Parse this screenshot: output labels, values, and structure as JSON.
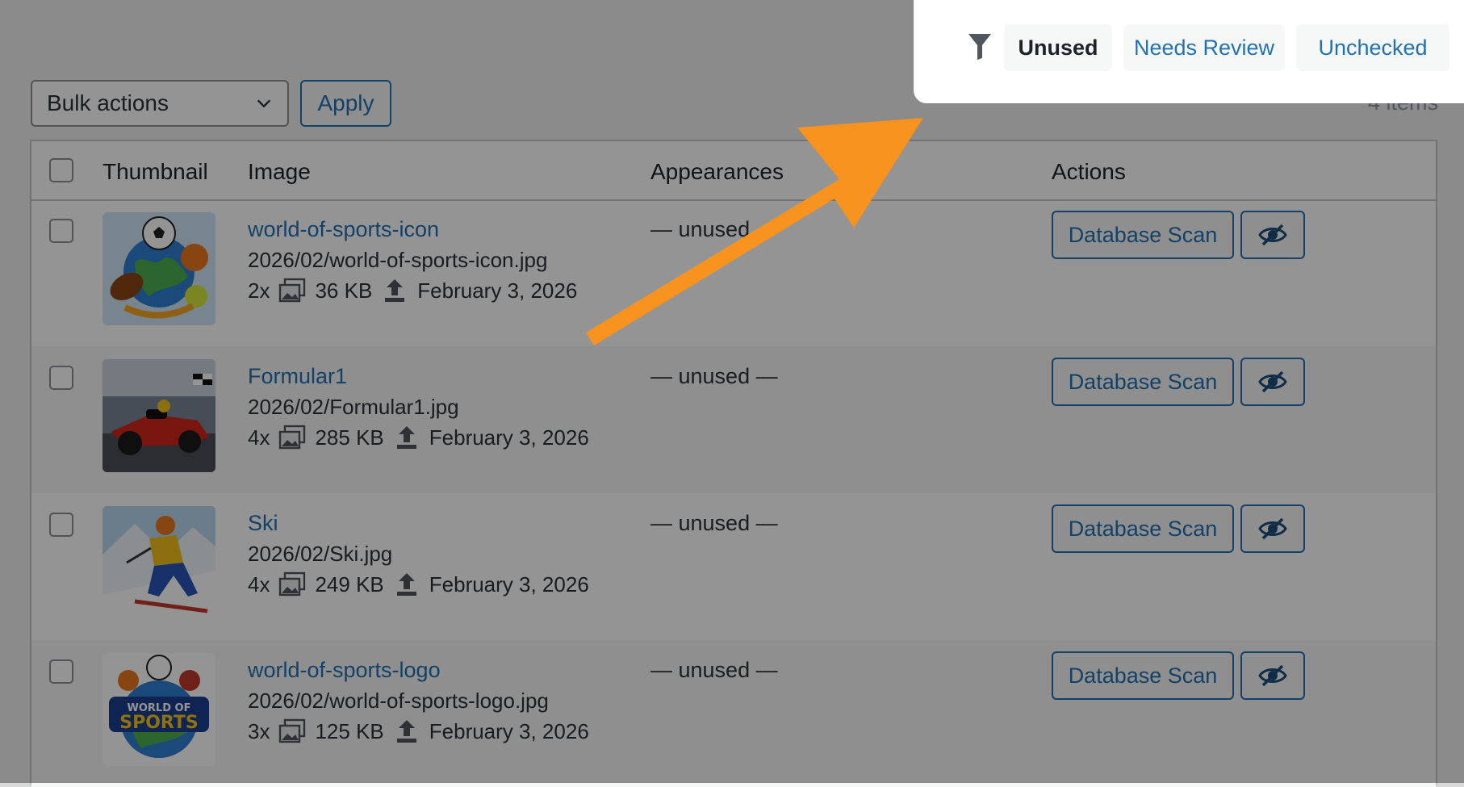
{
  "toolbar": {
    "bulk_select": "Bulk actions",
    "apply_label": "Apply",
    "items_count": "4 items"
  },
  "filters": {
    "icon": "filter-icon",
    "items": [
      {
        "label": "Unused",
        "state": "active"
      },
      {
        "label": "Needs Review",
        "state": "link"
      },
      {
        "label": "Unchecked",
        "state": "link"
      }
    ]
  },
  "table": {
    "headers": {
      "thumbnail": "Thumbnail",
      "image": "Image",
      "appearances": "Appearances",
      "actions": "Actions"
    },
    "rows": [
      {
        "title": "world-of-sports-icon",
        "path": "2026/02/world-of-sports-icon.jpg",
        "sizes": "2x",
        "filesize": "36 KB",
        "date": "February 3, 2026",
        "appearances": "— unused —",
        "scan_label": "Database Scan",
        "thumb": "globe-sports-balls"
      },
      {
        "title": "Formular1",
        "path": "2026/02/Formular1.jpg",
        "sizes": "4x",
        "filesize": "285 KB",
        "date": "February 3, 2026",
        "appearances": "— unused —",
        "scan_label": "Database Scan",
        "thumb": "formula-one-car"
      },
      {
        "title": "Ski",
        "path": "2026/02/Ski.jpg",
        "sizes": "4x",
        "filesize": "249 KB",
        "date": "February 3, 2026",
        "appearances": "— unused —",
        "scan_label": "Database Scan",
        "thumb": "skier"
      },
      {
        "title": "world-of-sports-logo",
        "path": "2026/02/world-of-sports-logo.jpg",
        "sizes": "3x",
        "filesize": "125 KB",
        "date": "February 3, 2026",
        "appearances": "— unused —",
        "scan_label": "Database Scan",
        "thumb": "world-of-sports-logo"
      }
    ]
  },
  "logo_text": "WORLD OF SPORTS",
  "colors": {
    "accent": "#2271b1",
    "arrow": "#f7931e",
    "overlay": "rgba(0,0,0,0.42)"
  }
}
